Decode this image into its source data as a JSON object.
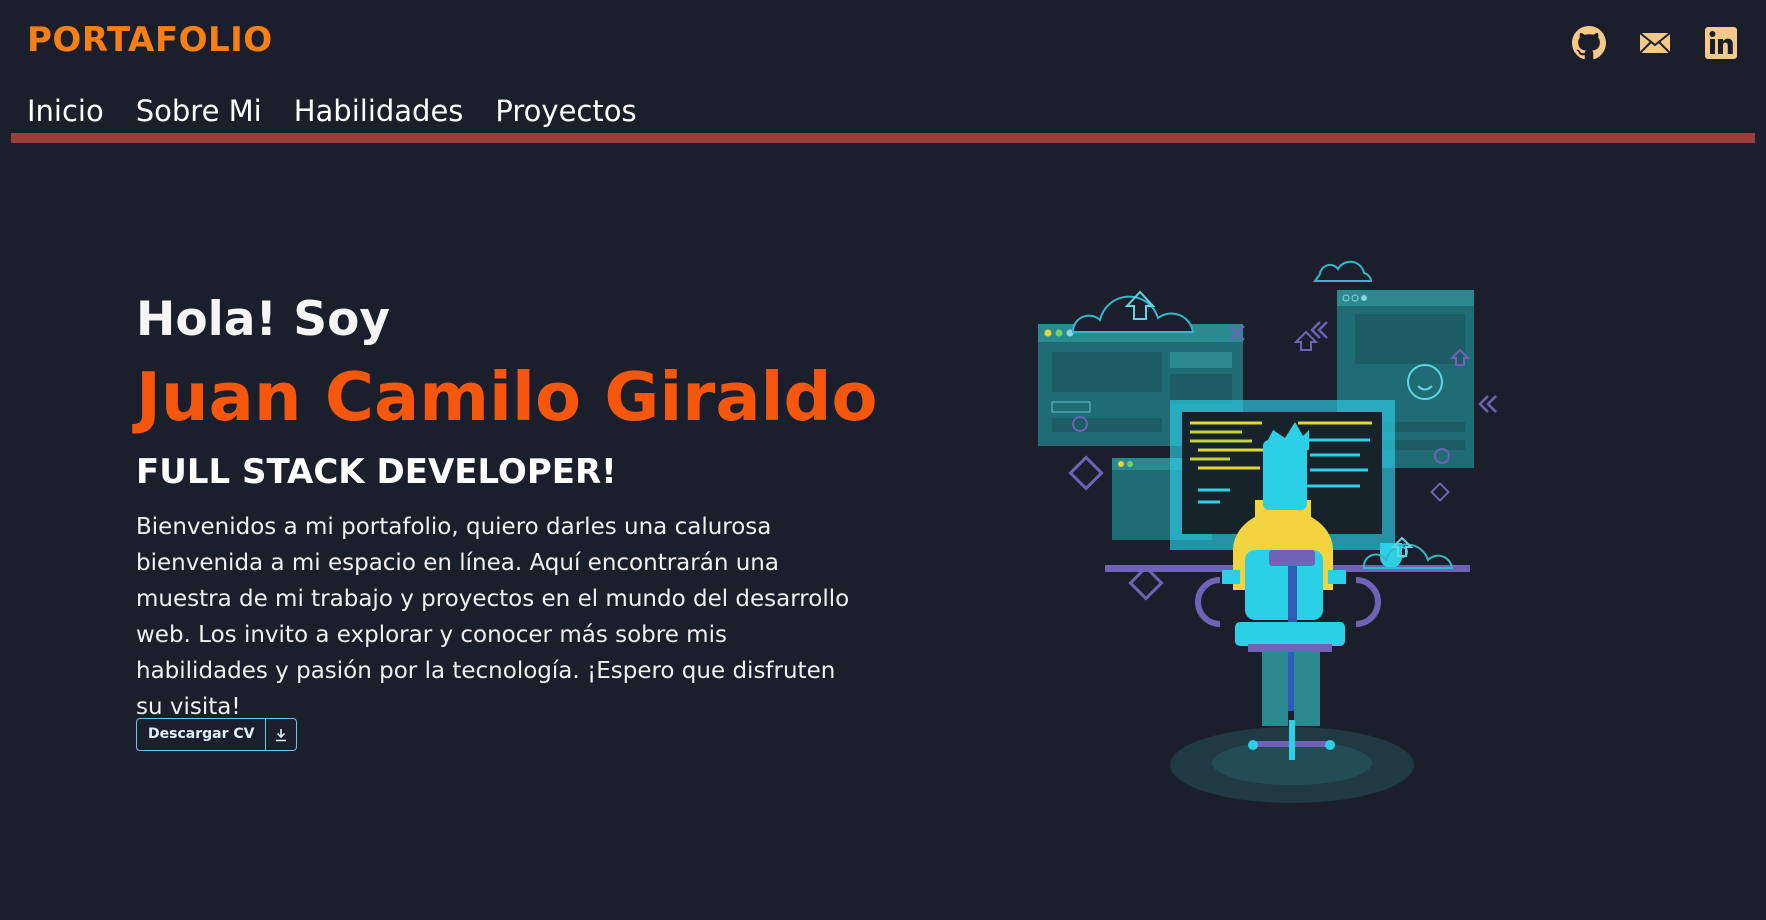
{
  "header": {
    "logo": "PORTAFOLIO",
    "socials": [
      {
        "icon": "github-icon"
      },
      {
        "icon": "mail-icon"
      },
      {
        "icon": "linkedin-icon"
      }
    ]
  },
  "nav": {
    "items": [
      "Inicio",
      "Sobre Mi",
      "Habilidades",
      "Proyectos"
    ]
  },
  "hero": {
    "greeting": "Hola! Soy",
    "name": "Juan Camilo Giraldo",
    "role": "FULL STACK DEVELOPER!",
    "description": "Bienvenidos a mi portafolio, quiero darles una calurosa bienvenida a mi espacio en línea. Aquí encontrarán una muestra de mi trabajo y proyectos en el mundo del desarrollo web. Los invito a explorar y conocer más sobre mis habilidades y pasión por la tecnología. ¡Espero que disfruten su visita!",
    "cv_button": "Descargar CV",
    "cv_icon": "download-icon"
  },
  "colors": {
    "background": "#1b1f2c",
    "accent_orange": "#f77f14",
    "name_orange": "#f7570d",
    "nav_line": "#9a3f3d",
    "social_icons": "#f6c98a",
    "button_border": "#6fc1e6"
  }
}
